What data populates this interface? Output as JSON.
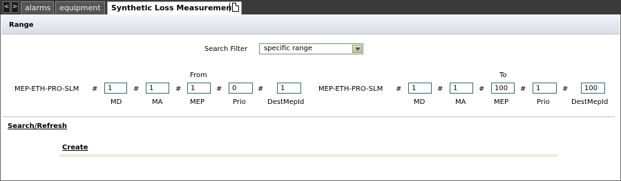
{
  "tabs": {
    "prev": "<",
    "next": ">",
    "items": [
      {
        "label": "alarms"
      },
      {
        "label": "equipment"
      },
      {
        "label": "Synthetic Loss Measurement"
      }
    ]
  },
  "range": {
    "title": "Range"
  },
  "search_filter": {
    "label": "Search Filter",
    "value": "specific range"
  },
  "from": {
    "heading": "From",
    "prefix": "MEP-ETH-PRO-SLM",
    "fields": {
      "md": "1",
      "ma": "1",
      "mep": "1",
      "prio": "0",
      "destmepid": "1"
    }
  },
  "to": {
    "heading": "To",
    "prefix": "MEP-ETH-PRO-SLM",
    "fields": {
      "md": "1",
      "ma": "1",
      "mep": "100",
      "prio": "1",
      "destmepid": "100"
    }
  },
  "captions": {
    "md": "MD",
    "ma": "MA",
    "mep": "MEP",
    "prio": "Prio",
    "destmepid": "DestMepId"
  },
  "hash": "#",
  "actions": {
    "search_refresh": "Search/Refresh",
    "create": "Create"
  }
}
